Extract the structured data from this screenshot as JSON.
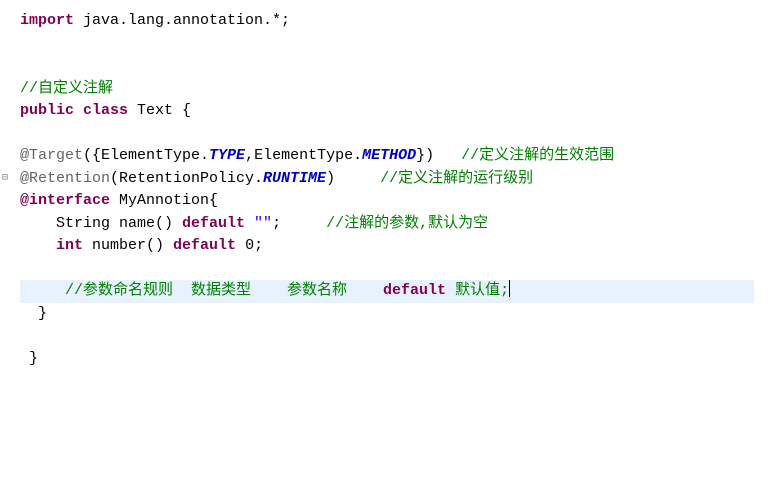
{
  "code": {
    "import_kw": "import",
    "import_stmt": " java.lang.annotation.*;",
    "comment1": "//自定义注解",
    "public_kw": "public",
    "class_kw": "class",
    "class_name": " Text {",
    "target_ann": "@Target",
    "target_args_open": "({ElementType.",
    "type_const": "TYPE",
    "target_comma": ",ElementType.",
    "method_const": "METHOD",
    "target_close": "})   ",
    "comment2": "//定义注解的生效范围",
    "retention_ann": "@Retention",
    "retention_open": "(RetentionPolicy.",
    "runtime_const": "RUNTIME",
    "retention_close": ")     ",
    "comment3": "//定义注解的运行级别",
    "interface_kw": "@interface",
    "interface_name": " MyAnnotion{",
    "string_line_indent": "    String name() ",
    "default_kw": "default",
    "empty_str": " \"\"",
    "semicolon": ";     ",
    "comment4": "//注解的参数,默认为空",
    "int_line_indent": "    ",
    "int_kw": "int",
    "int_rest": " number() ",
    "zero": " 0;",
    "highlight_indent": "     ",
    "comment5a": "//参数命名规则  数据类型    参数名称    ",
    "default_text": "default",
    "comment5b": " 默认值;",
    "close_brace": "  }",
    "final_brace": " }"
  }
}
